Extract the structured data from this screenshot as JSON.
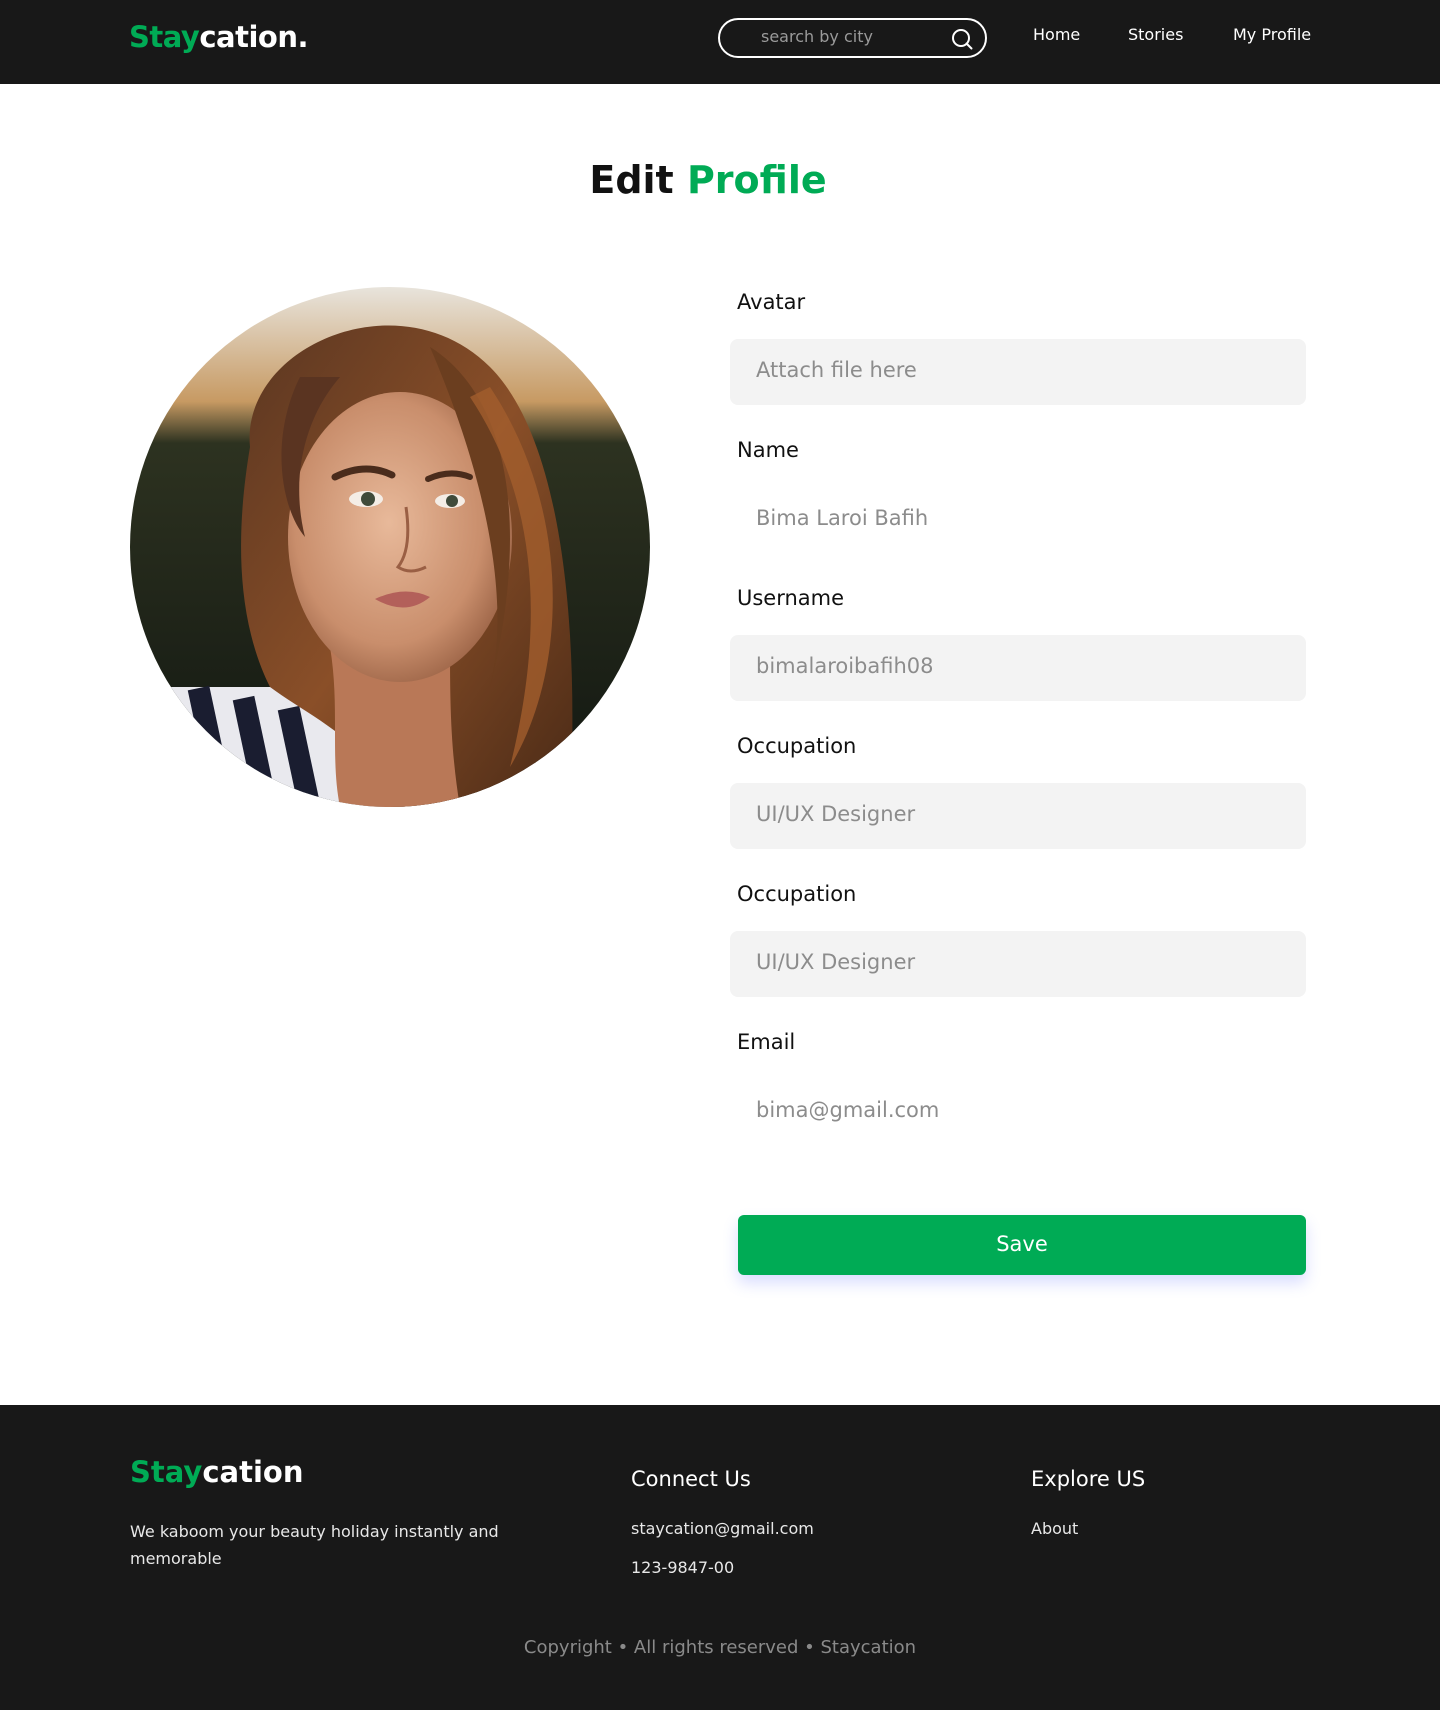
{
  "header": {
    "logo_first": "Stay",
    "logo_second": "cation.",
    "search_placeholder": "search by city",
    "nav": {
      "home": "Home",
      "stories": "Stories",
      "my_profile": "My Profile"
    }
  },
  "page": {
    "title_dark": "Edit",
    "title_green": "Profile"
  },
  "form": {
    "avatar": {
      "label": "Avatar",
      "value": "Attach file here"
    },
    "name": {
      "label": "Name",
      "value": "Bima Laroi Bafih"
    },
    "username": {
      "label": "Username",
      "value": "bimalaroibafih08"
    },
    "occupation_1": {
      "label": "Occupation",
      "value": "UI/UX Designer"
    },
    "occupation_2": {
      "label": "Occupation",
      "value": "UI/UX Designer"
    },
    "email": {
      "label": "Email",
      "value": "bima@gmail.com"
    },
    "save_label": "Save"
  },
  "footer": {
    "logo_first": "Stay",
    "logo_second": "cation",
    "tagline": "We kaboom your beauty holiday instantly and memorable",
    "connect_heading": "Connect Us",
    "connect_email": "staycation@gmail.com",
    "connect_phone": "123-9847-00",
    "explore_heading": "Explore  US",
    "explore_about": "About",
    "copyright": "Copyright • All rights reserved • Staycation"
  },
  "colors": {
    "brand_green": "#00ab55",
    "dark_bg": "#181818",
    "input_bg": "#f3f3f3"
  }
}
